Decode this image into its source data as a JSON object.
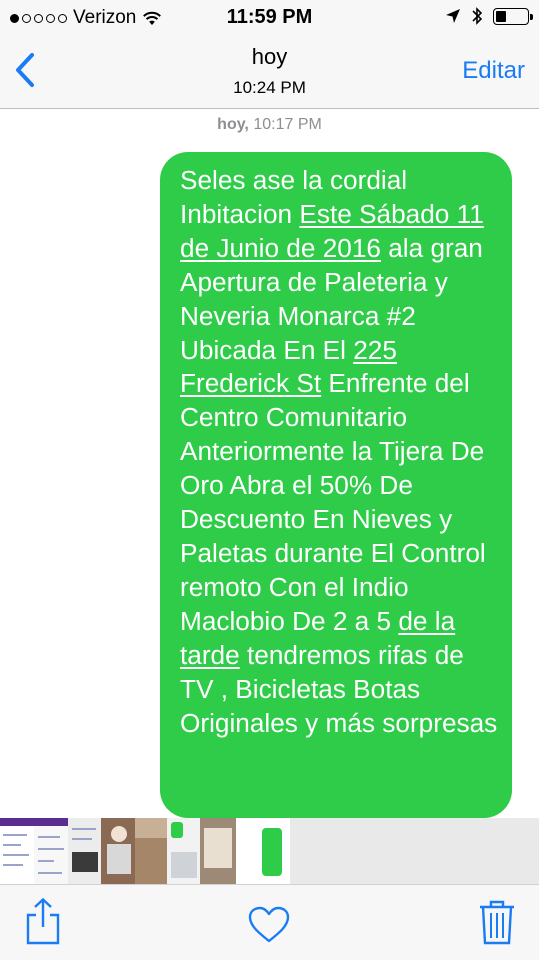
{
  "status_bar": {
    "signal_dots_filled": 1,
    "signal_dots_total": 5,
    "carrier": "Verizon",
    "time": "11:59 PM",
    "battery_level": 0.3
  },
  "nav": {
    "back_icon": "chevron-left-icon",
    "title": "hoy",
    "subtitle": "10:24 PM",
    "edit_label": "Editar"
  },
  "conversation": {
    "timestamp_day": "hoy,",
    "timestamp_time": "10:17 PM",
    "message": {
      "part1": "Seles ase la cordial Inbitacion ",
      "link_date": "Este Sábado 11 de Junio de 2016",
      "part2": " ala gran  Apertura de Paleteria y Neveria Monarca #2 Ubicada En El ",
      "link_address": "225 Frederick St",
      "part3": " Enfrente del Centro Comunitario Anteriormente la Tijera De Oro  Abra el 50% De Descuento En Nieves y Paletas durante El Control remoto Con el Indio Maclobio  De 2 a 5 ",
      "link_time": "de la tarde",
      "part4": " tendremos rifas de TV , Bicicletas Botas Originales y más sorpresas"
    }
  },
  "colors": {
    "bubble": "#2ecc49",
    "accent": "#1a7cf5",
    "bar_background": "#f7f7f7"
  },
  "toolbar": {
    "share_icon": "share-icon",
    "like_icon": "heart-icon",
    "delete_icon": "trash-icon"
  }
}
